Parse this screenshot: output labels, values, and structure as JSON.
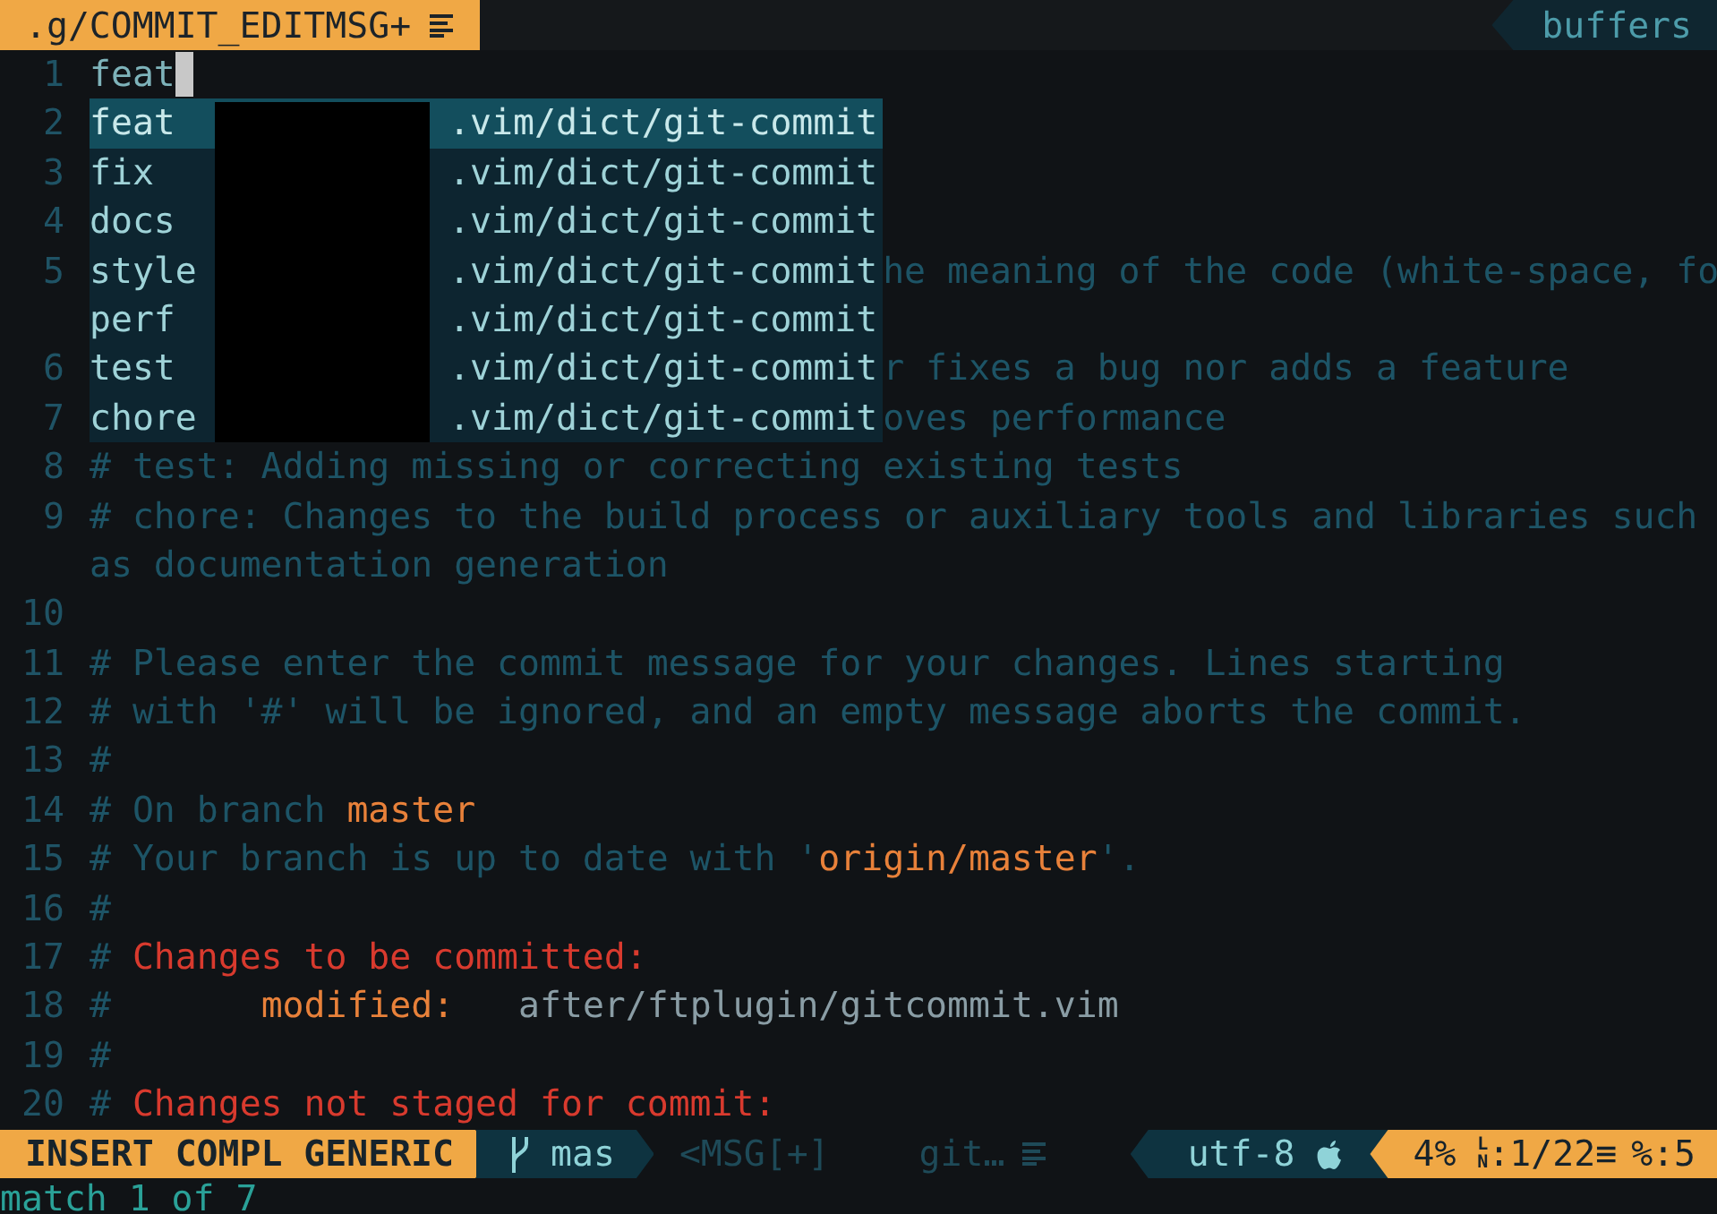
{
  "tabline": {
    "tab": {
      "label": ".g/COMMIT_EDITMSG+",
      "selected": true
    },
    "buffers_label": "buffers"
  },
  "editor": {
    "rows": [
      {
        "number": "1",
        "parts": [
          {
            "kind": "text",
            "text": "feat"
          }
        ],
        "cursor": true
      },
      {
        "number": "2",
        "parts": []
      },
      {
        "number": "3",
        "parts": []
      },
      {
        "number": "4",
        "parts": []
      },
      {
        "number": "5",
        "parts": [
          {
            "kind": "comment",
            "text": "he meaning of the code (white-space, fo"
          }
        ]
      },
      {
        "parts": []
      },
      {
        "number": "6",
        "parts": [
          {
            "kind": "comment",
            "text": "r fixes a bug nor adds a feature"
          }
        ]
      },
      {
        "number": "7",
        "parts": [
          {
            "kind": "comment",
            "text": "oves performance"
          }
        ]
      },
      {
        "number": "8",
        "parts": [
          {
            "kind": "comment",
            "text": "# test: Adding missing or correcting existing tests"
          }
        ]
      },
      {
        "number": "9",
        "parts": [
          {
            "kind": "comment",
            "text": "# chore: Changes to the build process or auxiliary tools and libraries such"
          }
        ]
      },
      {
        "parts": [
          {
            "kind": "comment",
            "text": "as documentation generation"
          }
        ]
      },
      {
        "number": "10",
        "parts": []
      },
      {
        "number": "11",
        "parts": [
          {
            "kind": "comment",
            "text": "# Please enter the commit message for your changes. Lines starting"
          }
        ]
      },
      {
        "number": "12",
        "parts": [
          {
            "kind": "comment",
            "text": "# with '#' will be ignored, and an empty message aborts the commit."
          }
        ]
      },
      {
        "number": "13",
        "parts": [
          {
            "kind": "comment",
            "text": "#"
          }
        ]
      },
      {
        "number": "14",
        "parts": [
          {
            "kind": "comment",
            "text": "# On branch "
          },
          {
            "kind": "keyword",
            "text": "master"
          }
        ]
      },
      {
        "number": "15",
        "parts": [
          {
            "kind": "comment",
            "text": "# Your branch is up to date with '"
          },
          {
            "kind": "keyword",
            "text": "origin/master"
          },
          {
            "kind": "comment",
            "text": "'."
          }
        ]
      },
      {
        "number": "16",
        "parts": [
          {
            "kind": "comment",
            "text": "#"
          }
        ]
      },
      {
        "number": "17",
        "parts": [
          {
            "kind": "comment",
            "text": "# "
          },
          {
            "kind": "heading",
            "text": "Changes to be committed:"
          }
        ]
      },
      {
        "number": "18",
        "parts": [
          {
            "kind": "comment",
            "text": "#       "
          },
          {
            "kind": "keyword",
            "text": "modified:"
          },
          {
            "kind": "path",
            "text": "   after/ftplugin/gitcommit.vim"
          }
        ]
      },
      {
        "number": "19",
        "parts": [
          {
            "kind": "comment",
            "text": "#"
          }
        ]
      },
      {
        "number": "20",
        "parts": [
          {
            "kind": "comment",
            "text": "# "
          },
          {
            "kind": "heading",
            "text": "Changes not staged for commit:"
          }
        ]
      }
    ]
  },
  "completion_menu": {
    "items": [
      {
        "word": "feat",
        "source": ".vim/dict/git-commit",
        "selected": true
      },
      {
        "word": "fix",
        "source": ".vim/dict/git-commit",
        "selected": false
      },
      {
        "word": "docs",
        "source": ".vim/dict/git-commit",
        "selected": false
      },
      {
        "word": "style",
        "source": ".vim/dict/git-commit",
        "selected": false
      },
      {
        "word": "perf",
        "source": ".vim/dict/git-commit",
        "selected": false
      },
      {
        "word": "test",
        "source": ".vim/dict/git-commit",
        "selected": false
      },
      {
        "word": "chore",
        "source": ".vim/dict/git-commit",
        "selected": false
      }
    ]
  },
  "status_bar": {
    "mode": "INSERT COMPL GENERIC",
    "branch": "mas",
    "filename": "<MSG[+]",
    "filetype": "git…",
    "encoding": "utf-8",
    "percent": "4%",
    "line_label_top": "L",
    "line_label_bottom": "N",
    "line": ":1/22≡",
    "column": "%:5"
  },
  "command_line": "match 1 of 7"
}
